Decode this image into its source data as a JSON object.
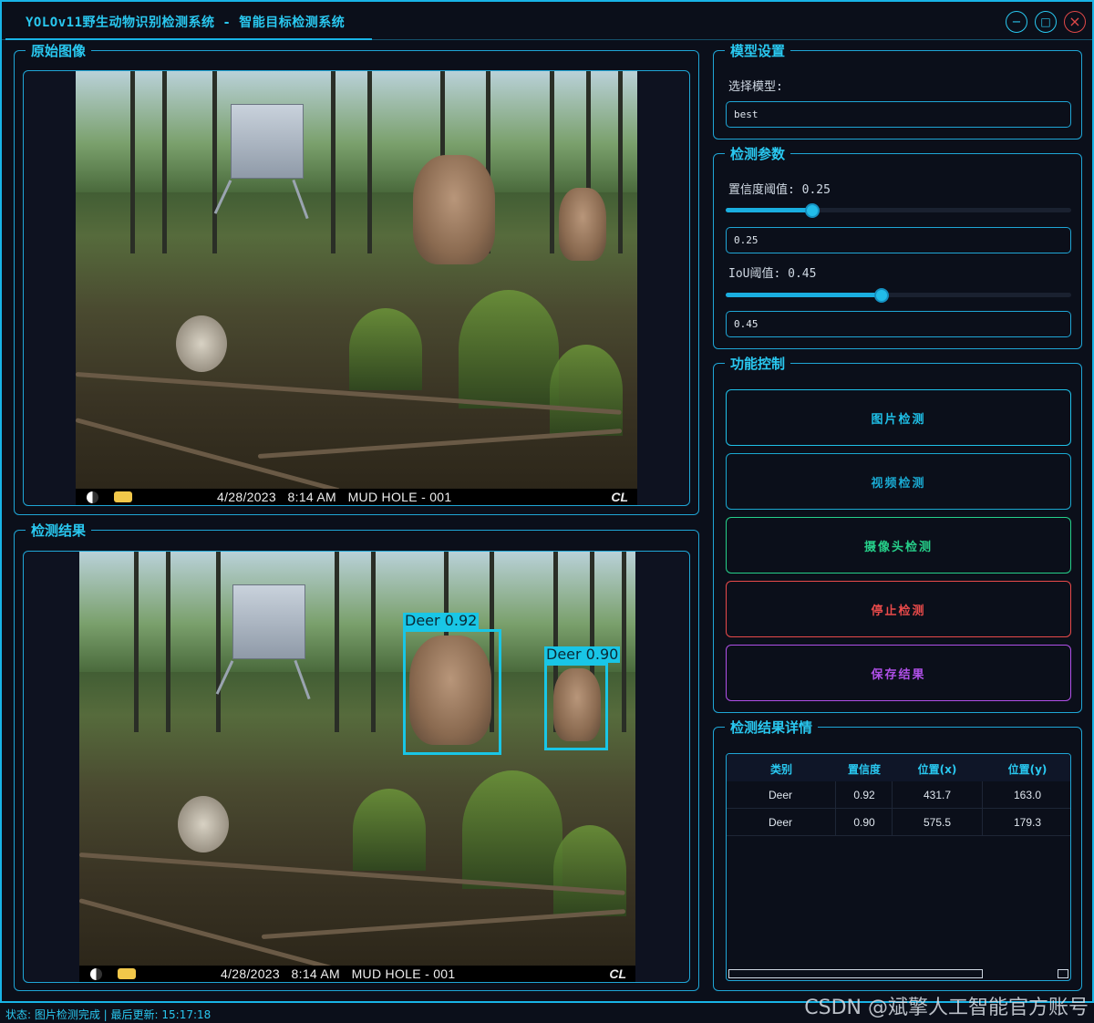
{
  "window": {
    "title": "YOLOv11野生动物识别检测系统 - 智能目标检测系统",
    "minimize_icon": "−",
    "maximize_icon": "□",
    "close_icon": "×"
  },
  "original_panel": {
    "title": "原始图像",
    "timestamp": "4/28/2023   8:14 AM   MUD HOLE - 001",
    "camera_logo": "CL"
  },
  "result_panel": {
    "title": "检测结果",
    "timestamp": "4/28/2023   8:14 AM   MUD HOLE - 001",
    "camera_logo": "CL",
    "detections": [
      {
        "label": "Deer 0.92"
      },
      {
        "label": "Deer 0.90"
      }
    ]
  },
  "model_settings": {
    "title": "模型设置",
    "select_label": "选择模型:",
    "selected_model": "best"
  },
  "detection_params": {
    "title": "检测参数",
    "confidence_label": "置信度阈值: 0.25",
    "confidence_value": "0.25",
    "confidence_fraction": 0.25,
    "iou_label": "IoU阈值: 0.45",
    "iou_value": "0.45",
    "iou_fraction": 0.45
  },
  "controls": {
    "title": "功能控制",
    "buttons": [
      {
        "label": "图片检测",
        "color": "#1fc0e8"
      },
      {
        "label": "视频检测",
        "color": "#1aa8d0"
      },
      {
        "label": "摄像头检测",
        "color": "#26d08a"
      },
      {
        "label": "停止检测",
        "color": "#e84a4a"
      },
      {
        "label": "保存结果",
        "color": "#b050e8"
      }
    ]
  },
  "results_table": {
    "title": "检测结果详情",
    "columns": [
      "类别",
      "置信度",
      "位置(x)",
      "位置(y)"
    ],
    "rows": [
      [
        "Deer",
        "0.92",
        "431.7",
        "163.0"
      ],
      [
        "Deer",
        "0.90",
        "575.5",
        "179.3"
      ]
    ]
  },
  "status_bar": {
    "text": "状态: 图片检测完成 | 最后更新: 15:17:18"
  },
  "watermark": "CSDN @斌擎人工智能官方账号",
  "colors": {
    "accent": "#1fa6d6",
    "title_text": "#29c8f0",
    "background": "#0b0f1a",
    "bbox": "#19c6e6"
  }
}
